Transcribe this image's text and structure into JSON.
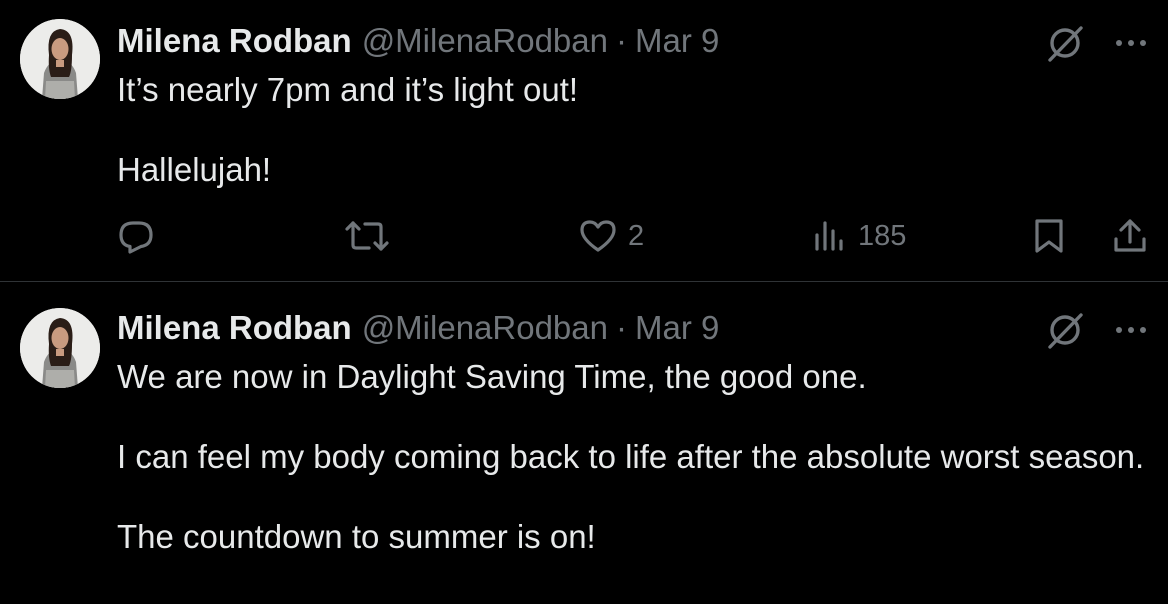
{
  "colors": {
    "background": "#000000",
    "text_primary": "#e7e9ea",
    "text_secondary": "#71767b",
    "divider": "#2f3336"
  },
  "tweets": [
    {
      "author": {
        "name": "Milena Rodban",
        "handle": "@MilenaRodban",
        "avatar_icon": "profile-photo"
      },
      "separator": "·",
      "date": "Mar 9",
      "body": [
        "It’s nearly 7pm and it’s light out!",
        "Hallelujah!"
      ],
      "metrics": {
        "replies": "",
        "retweets": "",
        "likes": "2",
        "views": "185"
      },
      "icons": [
        "grok-icon",
        "more-icon",
        "reply-icon",
        "retweet-icon",
        "like-icon",
        "views-icon",
        "bookmark-icon",
        "share-icon"
      ]
    },
    {
      "author": {
        "name": "Milena Rodban",
        "handle": "@MilenaRodban",
        "avatar_icon": "profile-photo"
      },
      "separator": "·",
      "date": "Mar 9",
      "body": [
        "We are now in Daylight Saving Time, the good one.",
        "I can feel my body coming back to life after the absolute worst season.",
        "The countdown to summer is on!"
      ],
      "icons": [
        "grok-icon",
        "more-icon"
      ]
    }
  ]
}
